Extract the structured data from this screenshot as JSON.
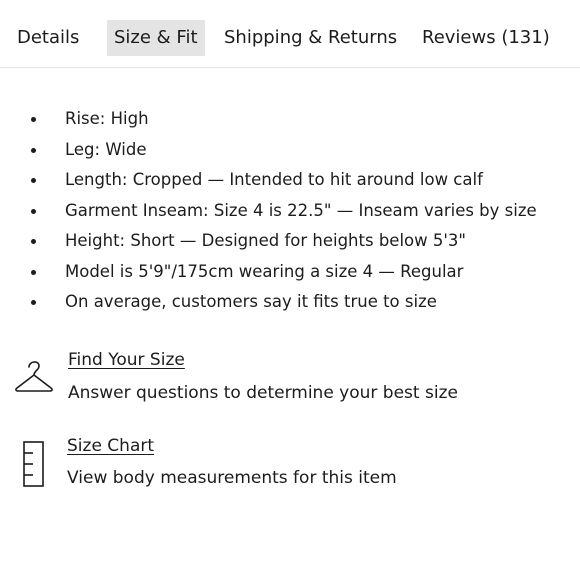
{
  "tabs": [
    {
      "label": "Details"
    },
    {
      "label": "Size & Fit"
    },
    {
      "label": "Shipping & Returns"
    },
    {
      "label": "Reviews (131)"
    }
  ],
  "active_tab": "Size & Fit",
  "fit_details": [
    "Rise: High",
    "Leg: Wide",
    "Length: Cropped — Intended to hit around low calf",
    "Garment Inseam: Size 4 is 22.5\" — Inseam varies by size",
    "Height: Short — Designed for heights below 5'3\"",
    "Model is 5'9\"/175cm wearing a size 4  —  Regular",
    "On average, customers say it fits true to size"
  ],
  "find_size": {
    "icon": "hanger-icon",
    "link": "Find Your Size",
    "description": "Answer questions to determine your best size"
  },
  "size_chart": {
    "icon": "ruler-icon",
    "link": "Size Chart",
    "description": "View body measurements for this item"
  }
}
